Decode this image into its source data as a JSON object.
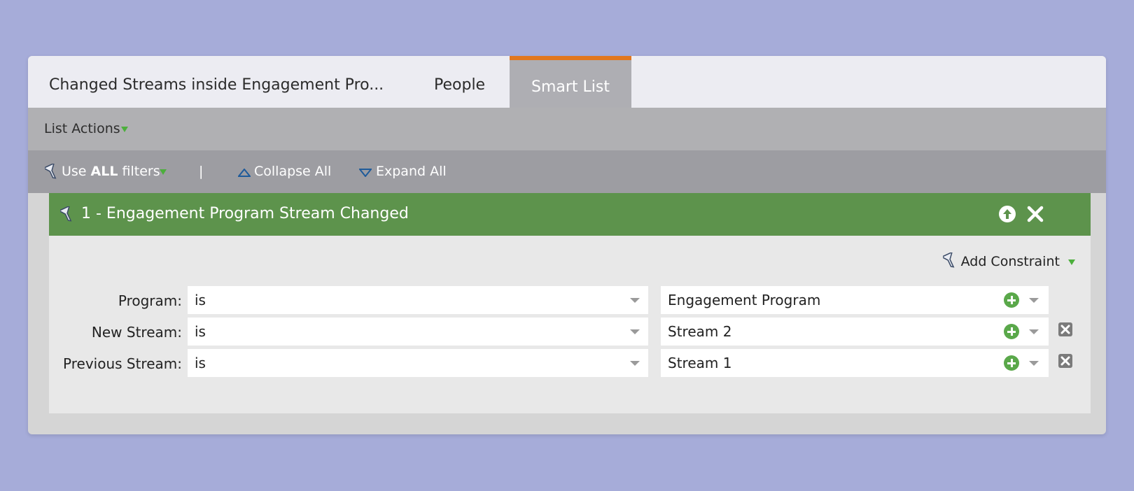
{
  "tabs": [
    {
      "label": "Changed Streams inside Engagement Pro..."
    },
    {
      "label": "People"
    },
    {
      "label": "Smart List"
    }
  ],
  "toolbar": {
    "list_actions": "List Actions",
    "use_prefix": "Use ",
    "use_all": "ALL",
    "use_suffix": " filters",
    "separator": "|",
    "collapse_all": "Collapse All",
    "expand_all": "Expand All"
  },
  "filter": {
    "title": "1 - Engagement Program Stream Changed",
    "add_constraint": "Add Constraint",
    "rows": [
      {
        "label": "Program:",
        "operator": "is",
        "value": "Engagement Program"
      },
      {
        "label": "New Stream:",
        "operator": "is",
        "value": "Stream 2"
      },
      {
        "label": "Previous Stream:",
        "operator": "is",
        "value": "Stream 1"
      }
    ]
  },
  "colors": {
    "background": "#a6acd9",
    "active_tab_accent": "#e2771f",
    "filter_header": "#5d934c",
    "plus_green": "#5aa84a"
  },
  "icons": [
    "funnel-icon",
    "dropdown-triangle-icon",
    "collapse-all-icon",
    "expand-all-icon",
    "move-up-icon",
    "close-icon",
    "add-value-icon",
    "delete-constraint-icon"
  ]
}
